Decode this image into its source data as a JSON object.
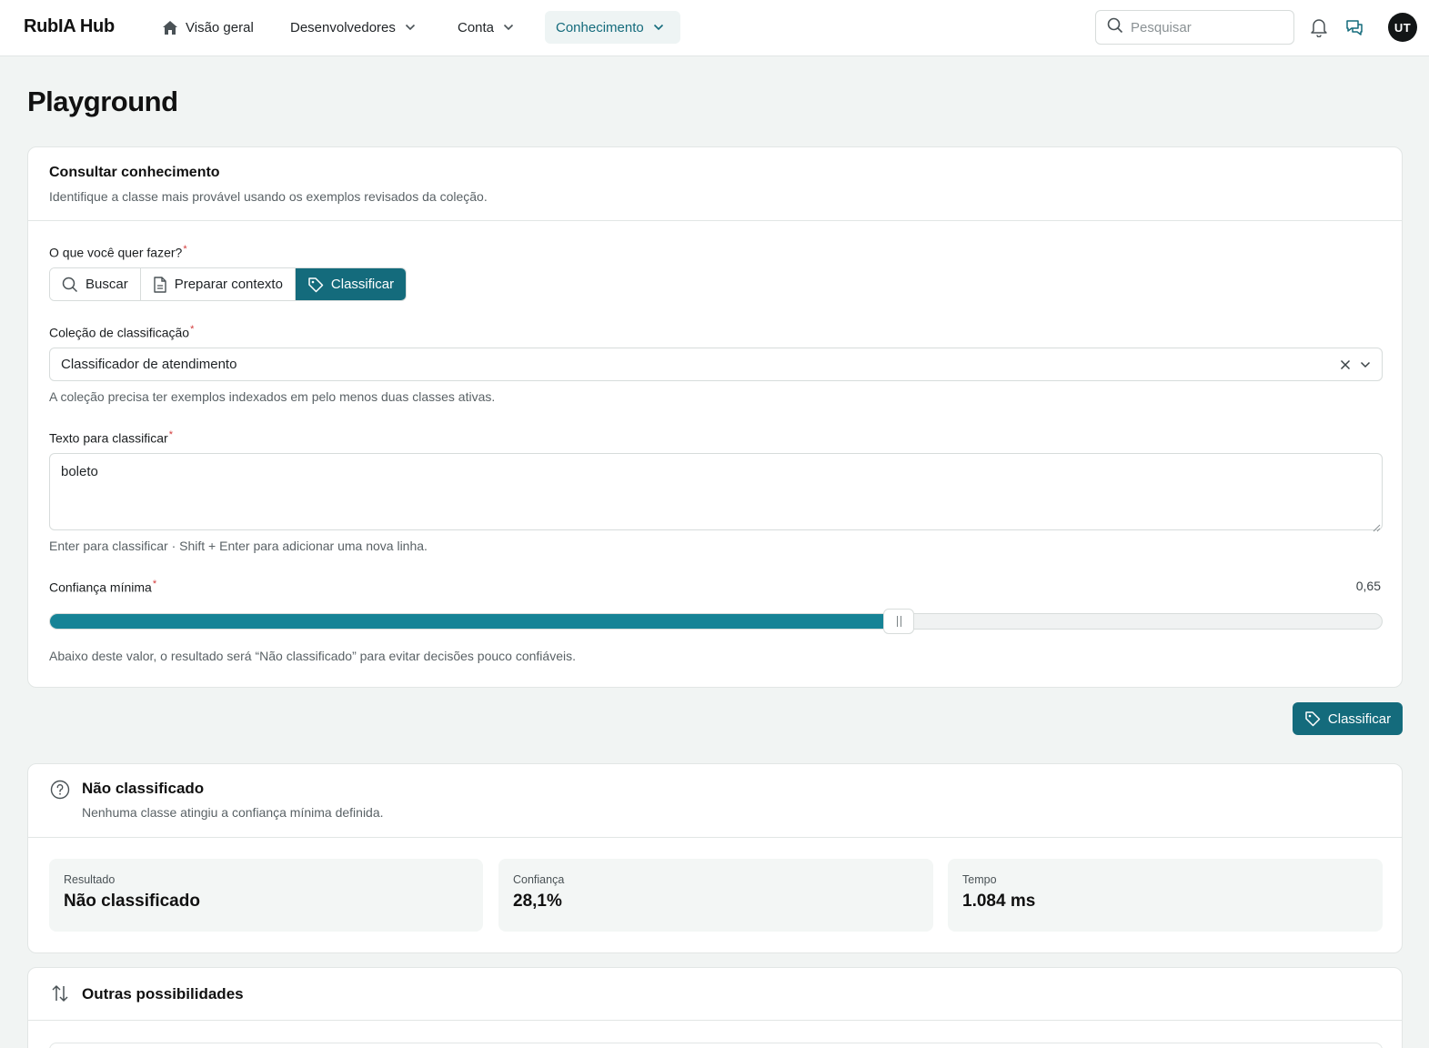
{
  "brand": "RubIA Hub",
  "nav": {
    "overview": "Visão geral",
    "developers": "Desenvolvedores",
    "account": "Conta",
    "knowledge": "Conhecimento"
  },
  "search": {
    "placeholder": "Pesquisar"
  },
  "user": {
    "initials": "UT"
  },
  "page": {
    "title": "Playground"
  },
  "query_card": {
    "title": "Consultar conhecimento",
    "subtitle": "Identifique a classe mais provável usando os exemplos revisados da coleção.",
    "action": {
      "label": "O que você quer fazer?",
      "required_mark": "*",
      "options": [
        "Buscar",
        "Preparar contexto",
        "Classificar"
      ],
      "selected": "Classificar"
    },
    "collection": {
      "label": "Coleção de classificação",
      "required_mark": "*",
      "value": "Classificador de atendimento",
      "hint": "A coleção precisa ter exemplos indexados em pelo menos duas classes ativas."
    },
    "text": {
      "label": "Texto para classificar",
      "required_mark": "*",
      "value": "boleto",
      "hint": "Enter para classificar · Shift + Enter para adicionar uma nova linha."
    },
    "confidence": {
      "label": "Confiança mínima",
      "required_mark": "*",
      "value_text": "0,65",
      "value": 0.65,
      "hint": "Abaixo deste valor, o resultado será “Não classificado” para evitar decisões pouco confiáveis."
    }
  },
  "submit_button": {
    "label": "Classificar"
  },
  "result_card": {
    "title": "Não classificado",
    "subtitle": "Nenhuma classe atingiu a confiança mínima definida.",
    "stats": [
      {
        "label": "Resultado",
        "value": "Não classificado"
      },
      {
        "label": "Confiança",
        "value": "28,1%"
      },
      {
        "label": "Tempo",
        "value": "1.084 ms"
      }
    ]
  },
  "other_card": {
    "title": "Outras possibilidades"
  },
  "colors": {
    "accent": "#146b7c",
    "slider_fill": "#168396",
    "required": "#d23b3b"
  }
}
